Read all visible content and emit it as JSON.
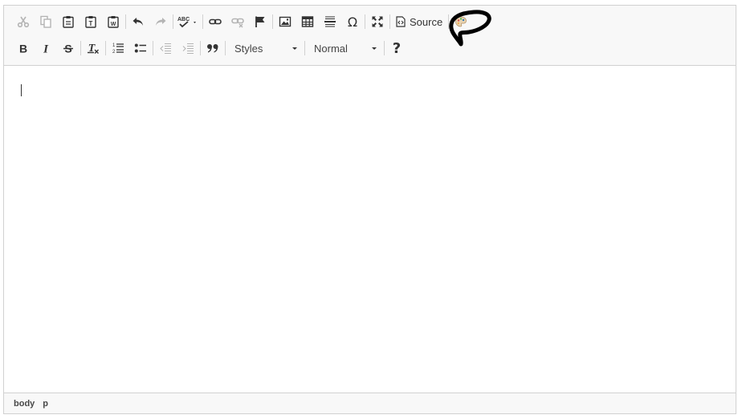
{
  "toolbar": {
    "row1": [
      {
        "name": "cut-icon",
        "state": "disabled"
      },
      {
        "name": "copy-icon",
        "state": "disabled"
      },
      {
        "name": "paste-icon",
        "state": "enabled"
      },
      {
        "name": "paste-text-icon",
        "state": "enabled"
      },
      {
        "name": "paste-from-word-icon",
        "state": "enabled"
      },
      {
        "name": "undo-icon",
        "state": "enabled"
      },
      {
        "name": "redo-icon",
        "state": "disabled"
      },
      {
        "name": "spellcheck-icon",
        "state": "enabled"
      },
      {
        "name": "link-icon",
        "state": "enabled"
      },
      {
        "name": "unlink-icon",
        "state": "disabled"
      },
      {
        "name": "anchor-icon",
        "state": "enabled"
      },
      {
        "name": "image-icon",
        "state": "enabled"
      },
      {
        "name": "table-icon",
        "state": "enabled"
      },
      {
        "name": "horizontal-line-icon",
        "state": "enabled"
      },
      {
        "name": "special-char-icon",
        "state": "enabled"
      },
      {
        "name": "maximize-icon",
        "state": "enabled"
      },
      {
        "name": "source-icon",
        "state": "enabled"
      },
      {
        "name": "plugin-palette-icon",
        "state": "enabled"
      }
    ],
    "source_label": "Source",
    "row2": [
      {
        "name": "bold-icon",
        "state": "enabled"
      },
      {
        "name": "italic-icon",
        "state": "enabled"
      },
      {
        "name": "strikethrough-icon",
        "state": "enabled"
      },
      {
        "name": "remove-format-icon",
        "state": "enabled"
      },
      {
        "name": "numbered-list-icon",
        "state": "enabled"
      },
      {
        "name": "bulleted-list-icon",
        "state": "enabled"
      },
      {
        "name": "outdent-icon",
        "state": "disabled"
      },
      {
        "name": "indent-icon",
        "state": "disabled"
      },
      {
        "name": "blockquote-icon",
        "state": "enabled"
      },
      {
        "name": "help-icon",
        "state": "enabled"
      }
    ],
    "styles_label": "Styles",
    "format_label": "Normal",
    "help_label": "?"
  },
  "colors": {
    "icon": "#333333",
    "icon_disabled": "#b4b4b4",
    "toolbar_bg": "#f8f8f8",
    "border": "#d1d1d1",
    "annotation": "#000000"
  },
  "statusbar": {
    "path": [
      "body",
      "p"
    ]
  }
}
